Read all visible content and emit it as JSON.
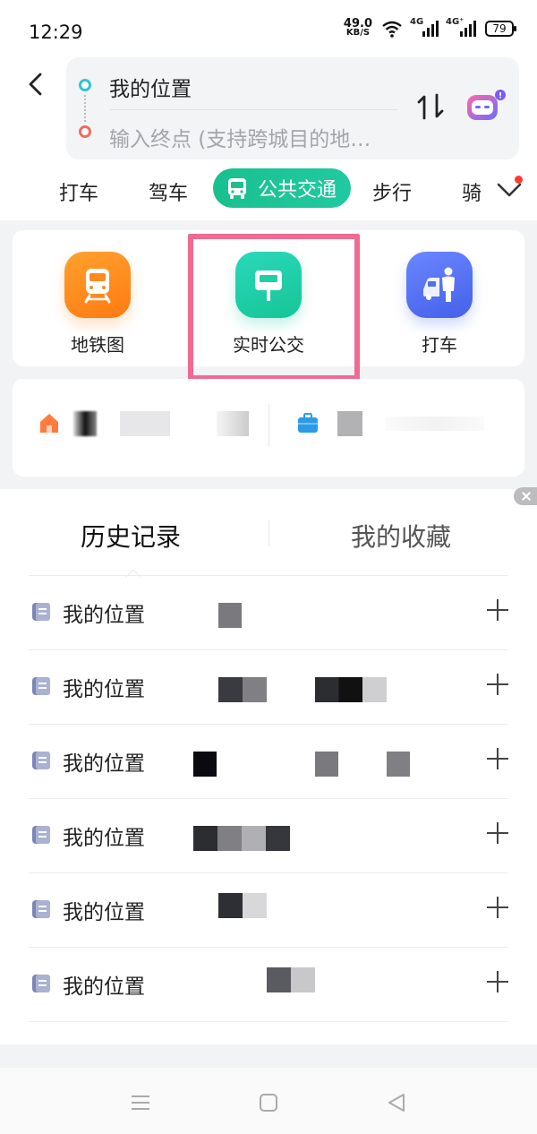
{
  "status_bar": {
    "time": "12:29",
    "net_speed_value": "49.0",
    "net_speed_unit": "KB/S",
    "signal_1": "4G",
    "signal_2": "4G⁺",
    "battery": "79"
  },
  "route": {
    "start": "我的位置",
    "end_placeholder": "输入终点 (支持跨城目的地…"
  },
  "mode_tabs": [
    {
      "label": "打车"
    },
    {
      "label": "驾车"
    },
    {
      "label": "公共交通",
      "active": true
    },
    {
      "label": "步行"
    },
    {
      "label": "骑"
    }
  ],
  "quick_entries": [
    {
      "label": "地铁图"
    },
    {
      "label": "实时公交"
    },
    {
      "label": "打车"
    }
  ],
  "sheet": {
    "tab_history": "历史记录",
    "tab_favorites": "我的收藏"
  },
  "history": [
    {
      "from": "我的位置"
    },
    {
      "from": "我的位置"
    },
    {
      "from": "我的位置"
    },
    {
      "from": "我的位置"
    },
    {
      "from": "我的位置"
    },
    {
      "from": "我的位置"
    }
  ],
  "colors": {
    "accent": "#1dc597",
    "metro": "#ff8a1f",
    "bus": "#1fcfa8",
    "taxi": "#4f6ff0",
    "highlight": "#f06a92"
  }
}
